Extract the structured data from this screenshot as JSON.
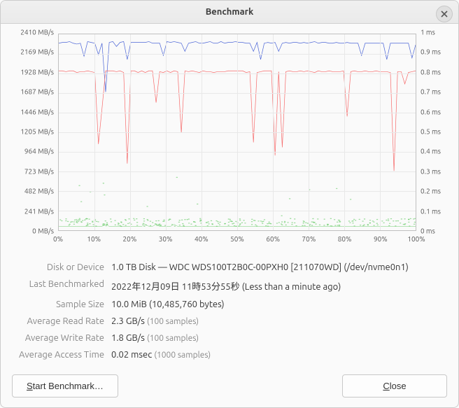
{
  "window": {
    "title": "Benchmark"
  },
  "chart_data": {
    "type": "line",
    "x_ticks": [
      "0%",
      "10%",
      "20%",
      "30%",
      "40%",
      "50%",
      "60%",
      "70%",
      "80%",
      "90%",
      "100%"
    ],
    "y_left_ticks": [
      "0 MB/s",
      "241 MB/s",
      "482 MB/s",
      "723 MB/s",
      "964 MB/s",
      "1205 MB/s",
      "1446 MB/s",
      "1687 MB/s",
      "1928 MB/s",
      "2169 MB/s",
      "2410 MB/s"
    ],
    "y_right_ticks": [
      "0 ms",
      "0.1 ms",
      "0.2 ms",
      "0.3 ms",
      "0.4 ms",
      "0.5 ms",
      "0.6 ms",
      "0.7 ms",
      "0.8 ms",
      "0.9 ms",
      "1 ms"
    ],
    "y_left_range": [
      0,
      2410
    ],
    "y_right_range": [
      0,
      1
    ],
    "series": [
      {
        "name": "read-rate",
        "axis": "left",
        "color": "#4a64d6",
        "values": [
          2300,
          2310,
          2310,
          2320,
          2300,
          2290,
          2300,
          2140,
          2320,
          2310,
          2300,
          2160,
          2300,
          1700,
          2310,
          2320,
          2260,
          2310,
          2320,
          2100,
          2310,
          2310,
          2310,
          2310,
          2310,
          2320,
          2300,
          2300,
          2300,
          2150,
          2320,
          2310,
          2320,
          2310,
          2300,
          2200,
          2300,
          2310,
          2320,
          2300,
          2300,
          2310,
          2320,
          2300,
          2300,
          2320,
          2300,
          2310,
          2310,
          2320,
          2310,
          2310,
          2300,
          2300,
          2200,
          2310,
          2100,
          2300,
          2310,
          2300,
          2310,
          2200,
          2300,
          2310,
          2300,
          2310,
          2310,
          2300,
          2310,
          2300,
          2310,
          2320,
          2300,
          2310,
          2310,
          2300,
          2300,
          2310,
          2300,
          2300,
          2310,
          2300,
          2300,
          2300,
          2150,
          2300,
          2300,
          2300,
          2300,
          2300,
          2300,
          2100,
          2300,
          2300,
          2300,
          2300,
          2300,
          2300,
          2120,
          2280
        ]
      },
      {
        "name": "write-rate",
        "axis": "left",
        "color": "#f66a6a",
        "values": [
          1960,
          1960,
          1950,
          1960,
          1960,
          1940,
          1950,
          1950,
          1960,
          1950,
          1940,
          1060,
          1500,
          1960,
          1960,
          1960,
          1950,
          1960,
          1940,
          820,
          1960,
          1960,
          1940,
          1960,
          1940,
          1960,
          1960,
          1570,
          1950,
          1940,
          1960,
          1940,
          1960,
          1950,
          1200,
          1960,
          1950,
          1960,
          1950,
          1940,
          1960,
          1950,
          1950,
          1940,
          1950,
          1950,
          1950,
          1960,
          1960,
          1960,
          1960,
          1960,
          1940,
          1950,
          1080,
          1940,
          1950,
          1960,
          1960,
          1960,
          920,
          1950,
          1020,
          1950,
          1960,
          1950,
          1950,
          1960,
          1950,
          1960,
          1950,
          1940,
          1960,
          1950,
          1950,
          1960,
          1950,
          1950,
          1950,
          1960,
          1400,
          1950,
          1960,
          1950,
          1950,
          1960,
          1950,
          1950,
          1960,
          1950,
          1950,
          1950,
          1940,
          730,
          1950,
          1950,
          1800,
          1940,
          1950,
          1960
        ]
      },
      {
        "name": "access-time",
        "axis": "right",
        "color": "#4ec24e",
        "values": [
          0.02,
          0.02,
          0.02,
          0.02,
          0.02,
          0.02,
          0.02,
          0.02,
          0.02,
          0.02,
          0.02,
          0.02,
          0.02,
          0.03,
          0.02,
          0.02,
          0.02,
          0.02,
          0.02,
          0.02,
          0.02,
          0.02,
          0.02,
          0.02,
          0.03,
          0.02,
          0.02,
          0.03,
          0.02,
          0.02,
          0.02,
          0.02,
          0.03,
          0.02,
          0.02,
          0.02,
          0.02,
          0.02,
          0.02,
          0.02,
          0.02,
          0.02,
          0.02,
          0.02,
          0.02,
          0.02,
          0.02,
          0.02,
          0.02,
          0.02,
          0.02,
          0.02,
          0.02,
          0.02,
          0.02,
          0.02,
          0.02,
          0.02,
          0.02,
          0.02,
          0.02,
          0.02,
          0.02,
          0.02,
          0.02,
          0.02,
          0.02,
          0.02,
          0.02,
          0.02,
          0.02,
          0.02,
          0.02,
          0.02,
          0.02,
          0.02,
          0.02,
          0.02,
          0.02,
          0.02,
          0.02,
          0.02,
          0.02,
          0.02,
          0.02,
          0.02,
          0.02,
          0.02,
          0.02,
          0.02,
          0.02,
          0.02,
          0.02,
          0.02,
          0.02,
          0.02,
          0.02,
          0.02,
          0.02,
          0.02
        ]
      }
    ]
  },
  "info": {
    "labels": {
      "device": "Disk or Device",
      "last": "Last Benchmarked",
      "sample": "Sample Size",
      "read": "Average Read Rate",
      "write": "Average Write Rate",
      "access": "Average Access Time"
    },
    "device": "1.0 TB Disk — WDC WDS100T2B0C-00PXH0 [211070WD] (/dev/nvme0n1)",
    "last": "2022年12月09日 11時53分55秒 (Less than a minute ago)",
    "sample": "10.0 MiB (10,485,760 bytes)",
    "read_value": "2.3 GB/s ",
    "read_sub": "(100 samples)",
    "write_value": "1.8 GB/s ",
    "write_sub": "(100 samples)",
    "access_value": "0.02 msec ",
    "access_sub": "(1000 samples)"
  },
  "buttons": {
    "start_pre": "S",
    "start_post": "tart Benchmark…",
    "close_pre": "C",
    "close_post": "lose"
  }
}
